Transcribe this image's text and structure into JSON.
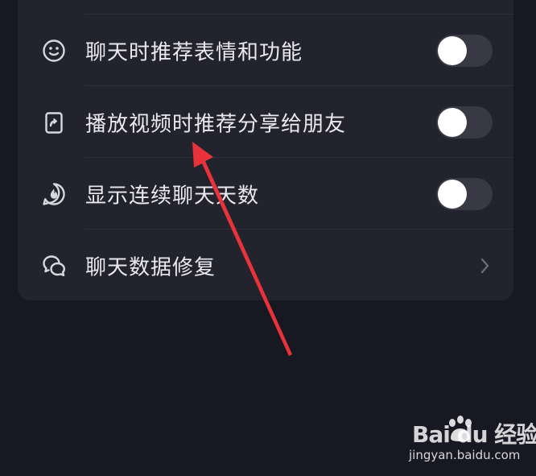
{
  "settings": {
    "items": [
      {
        "label": "聊天时推荐表情和功能",
        "icon": "smiley-icon",
        "control": "toggle",
        "on": false
      },
      {
        "label": "播放视频时推荐分享给朋友",
        "icon": "share-video-icon",
        "control": "toggle",
        "on": false
      },
      {
        "label": "显示连续聊天天数",
        "icon": "flame-chat-icon",
        "control": "toggle",
        "on": false
      },
      {
        "label": "聊天数据修复",
        "icon": "chat-repair-icon",
        "control": "chevron"
      }
    ]
  },
  "annotation": {
    "color": "#e8333a",
    "icon": "red-arrow-annotation"
  },
  "watermark": {
    "logo": "Bai du 经验",
    "url": "jingyan.baidu.com"
  },
  "colors": {
    "background": "#171821",
    "card": "#22232d",
    "toggle_track": "#383945",
    "toggle_knob": "#ffffff",
    "text": "#e9e9ee",
    "icon": "#d7d8de"
  }
}
